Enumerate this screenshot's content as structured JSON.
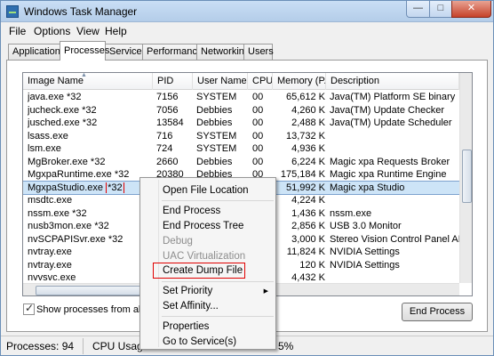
{
  "window": {
    "title": "Windows Task Manager",
    "min": "—",
    "max": "□",
    "close": "✕"
  },
  "menubar": [
    "File",
    "Options",
    "View",
    "Help"
  ],
  "tabs": [
    "Applications",
    "Processes",
    "Services",
    "Performance",
    "Networking",
    "Users"
  ],
  "columns": [
    "Image Name",
    "PID",
    "User Name",
    "CPU",
    "Memory (P...",
    "Description"
  ],
  "processes": [
    {
      "name": "java.exe *32",
      "pid": "7156",
      "user": "SYSTEM",
      "cpu": "00",
      "mem": "65,612 K",
      "desc": "Java(TM) Platform SE binary"
    },
    {
      "name": "jucheck.exe *32",
      "pid": "7056",
      "user": "Debbies",
      "cpu": "00",
      "mem": "4,260 K",
      "desc": "Java(TM) Update Checker"
    },
    {
      "name": "jusched.exe *32",
      "pid": "13584",
      "user": "Debbies",
      "cpu": "00",
      "mem": "2,488 K",
      "desc": "Java(TM) Update Scheduler"
    },
    {
      "name": "lsass.exe",
      "pid": "716",
      "user": "SYSTEM",
      "cpu": "00",
      "mem": "13,732 K",
      "desc": ""
    },
    {
      "name": "lsm.exe",
      "pid": "724",
      "user": "SYSTEM",
      "cpu": "00",
      "mem": "4,936 K",
      "desc": ""
    },
    {
      "name": "MgBroker.exe *32",
      "pid": "2660",
      "user": "Debbies",
      "cpu": "00",
      "mem": "6,224 K",
      "desc": "Magic xpa Requests Broker"
    },
    {
      "name": "MgxpaRuntime.exe *32",
      "pid": "20380",
      "user": "Debbies",
      "cpu": "00",
      "mem": "175,184 K",
      "desc": "Magic xpa Runtime Engine"
    },
    {
      "name": "MgxpaStudio.exe *32",
      "pid": "",
      "user": "",
      "cpu": "",
      "mem": "51,992 K",
      "desc": "Magic xpa Studio"
    },
    {
      "name": "msdtc.exe",
      "pid": "",
      "user": "",
      "cpu": "",
      "mem": "4,224 K",
      "desc": ""
    },
    {
      "name": "nssm.exe *32",
      "pid": "",
      "user": "",
      "cpu": "",
      "mem": "1,436 K",
      "desc": "nssm.exe"
    },
    {
      "name": "nusb3mon.exe *32",
      "pid": "",
      "user": "",
      "cpu": "",
      "mem": "2,856 K",
      "desc": "USB 3.0 Monitor"
    },
    {
      "name": "nvSCPAPISvr.exe *32",
      "pid": "",
      "user": "",
      "cpu": "",
      "mem": "3,000 K",
      "desc": "Stereo Vision Control Panel API Serv"
    },
    {
      "name": "nvtray.exe",
      "pid": "",
      "user": "",
      "cpu": "",
      "mem": "11,824 K",
      "desc": "NVIDIA Settings"
    },
    {
      "name": "nvtray.exe",
      "pid": "",
      "user": "",
      "cpu": "",
      "mem": "120 K",
      "desc": "NVIDIA Settings"
    },
    {
      "name": "nvvsvc.exe",
      "pid": "",
      "user": "",
      "cpu": "",
      "mem": "4,432 K",
      "desc": ""
    },
    {
      "name": "",
      "pid": "",
      "user": "",
      "cpu": "",
      "mem": "",
      "desc": ""
    }
  ],
  "selected_row": 7,
  "show_all_label": "Show processes from all use",
  "end_process_label": "End Process",
  "status": {
    "processes": "Processes: 94",
    "cpu": "CPU Usage:",
    "mem_tail": "5%"
  },
  "context_menu": {
    "open_file_location": "Open File Location",
    "end_process": "End Process",
    "end_process_tree": "End Process Tree",
    "debug": "Debug",
    "uac_virtualization": "UAC Virtualization",
    "create_dump_file": "Create Dump File",
    "set_priority": "Set Priority",
    "set_affinity": "Set Affinity...",
    "properties": "Properties",
    "go_to_services": "Go to Service(s)"
  },
  "colors": {
    "highlight": "#e00000",
    "selection": "#cde4f7",
    "titlebar": "#b4cde9"
  }
}
